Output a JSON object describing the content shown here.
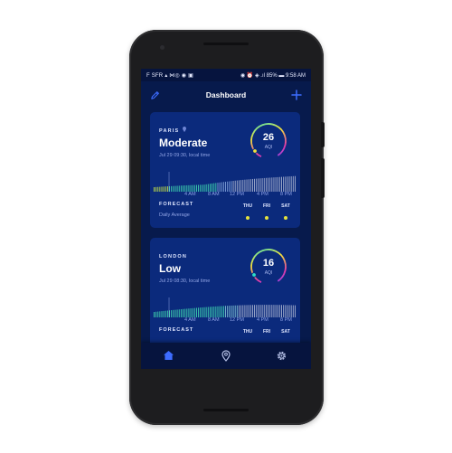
{
  "status_bar": {
    "carrier": "F SFR",
    "left_icons": "▴ ⋈◎ ◉ ▣",
    "right_text": "◉ ⏰ ◈ .ıl 85% ▬ 9:58 AM"
  },
  "app_bar": {
    "title": "Dashboard",
    "left_icon": "pencil-icon",
    "right_icon": "plus-icon"
  },
  "cards": [
    {
      "city": "PARIS",
      "level": "Moderate",
      "time": "Jul 29 09:30, local time",
      "aqi": "26",
      "aqi_unit": "AQI",
      "ticks": [
        "4 AM",
        "8 AM",
        "12 PM",
        "4 PM",
        "8 PM"
      ],
      "forecast_title": "FORECAST",
      "forecast_sub": "Daily Average",
      "days": [
        "THU",
        "FRI",
        "SAT"
      ],
      "aqi_fraction": 0.26,
      "bar_color_mode": "paris"
    },
    {
      "city": "LONDON",
      "level": "Low",
      "time": "Jul 29 08:30, local time",
      "aqi": "16",
      "aqi_unit": "AQI",
      "ticks": [
        "4 AM",
        "8 AM",
        "12 PM",
        "4 PM",
        "8 PM"
      ],
      "forecast_title": "FORECAST",
      "forecast_sub": "",
      "days": [
        "THU",
        "FRI",
        "SAT"
      ],
      "aqi_fraction": 0.16,
      "bar_color_mode": "london"
    }
  ],
  "bottom_nav": [
    "home-icon",
    "location-pin-icon",
    "settings-gear-icon"
  ],
  "colors": {
    "background": "#071a4c",
    "card": "#0b2a7c",
    "accent_nav": "#3d6cff",
    "forecast_dot": "#e6e33c",
    "gauge_gradient": [
      "#2ee0c8",
      "#f1e23a",
      "#e53aa8",
      "#6b4bff"
    ]
  }
}
